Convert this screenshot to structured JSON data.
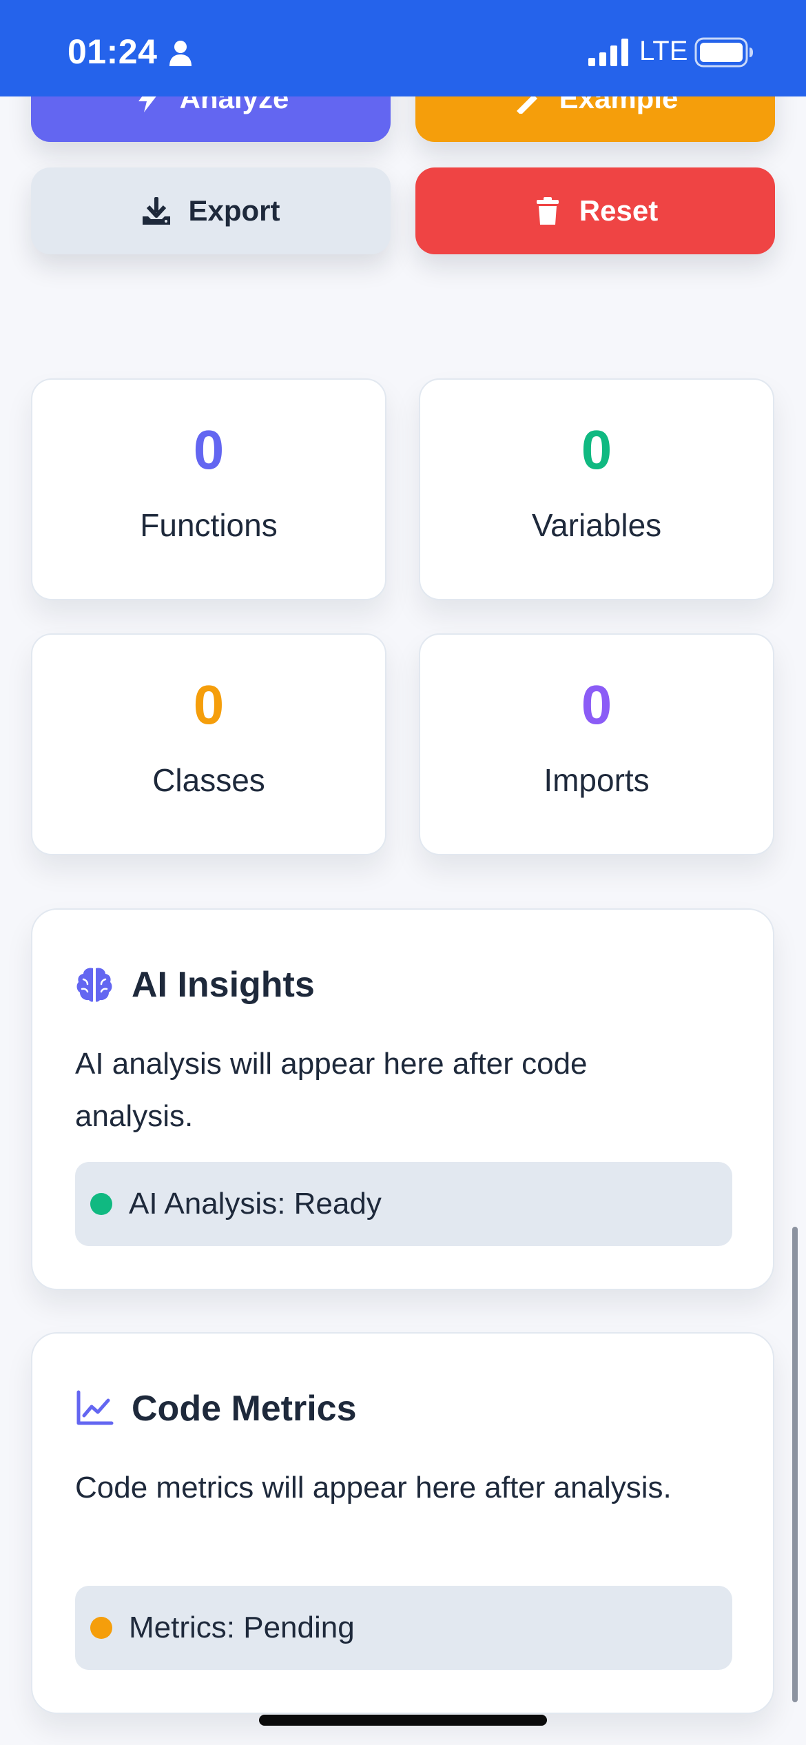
{
  "status_bar": {
    "time": "01:24",
    "network": "LTE",
    "icons": [
      "person-icon",
      "signal-icon",
      "battery-icon"
    ]
  },
  "actions": {
    "analyze_label": "Analyze",
    "example_label": "Example",
    "export_label": "Export",
    "reset_label": "Reset"
  },
  "stats": [
    {
      "value": "0",
      "label": "Functions",
      "color": "#6366f1"
    },
    {
      "value": "0",
      "label": "Variables",
      "color": "#10b981"
    },
    {
      "value": "0",
      "label": "Classes",
      "color": "#f59e0b"
    },
    {
      "value": "0",
      "label": "Imports",
      "color": "#8b5cf6"
    }
  ],
  "insights": {
    "icon": "brain-icon",
    "title": "AI Insights",
    "text": "AI analysis will appear here after code analysis.",
    "status": "AI Analysis: Ready",
    "status_color": "#10b981"
  },
  "metrics": {
    "icon": "chart-line-icon",
    "title": "Code Metrics",
    "text": "Code metrics will appear here after analysis.",
    "status": "Metrics: Pending",
    "status_color": "#f59e0b"
  },
  "colors": {
    "status_bar": "#2563eb",
    "accent": "#6366f1",
    "danger": "#ef4444",
    "warning": "#f59e0b",
    "success": "#10b981"
  }
}
